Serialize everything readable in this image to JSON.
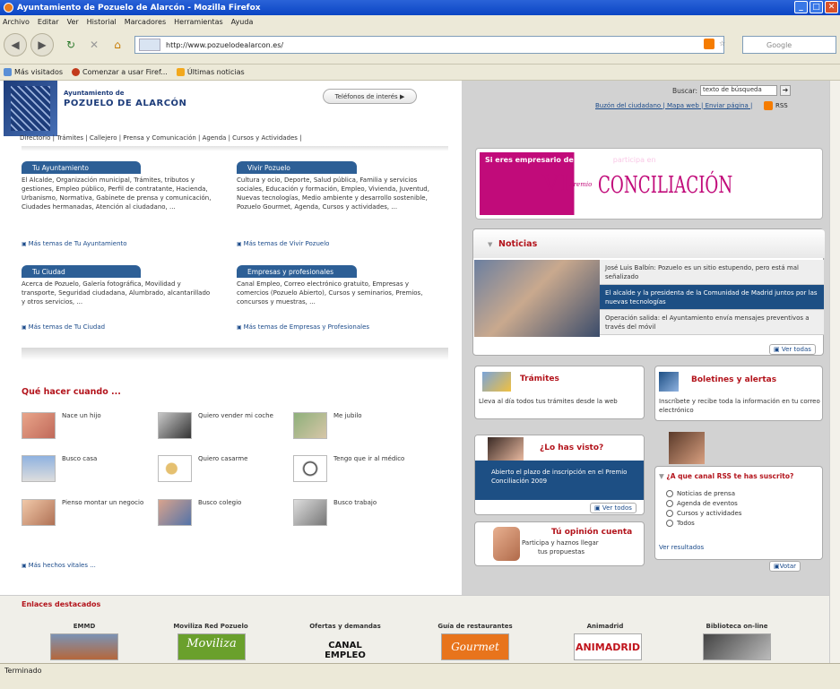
{
  "window": {
    "title": "Ayuntamiento de Pozuelo de Alarcón - Mozilla Firefox"
  },
  "menu": [
    "Archivo",
    "Editar",
    "Ver",
    "Historial",
    "Marcadores",
    "Herramientas",
    "Ayuda"
  ],
  "nav": {
    "url": "http://www.pozuelodealarcon.es/",
    "search_placeholder": "Google"
  },
  "bookmarks": [
    "Más visitados",
    "Comenzar a usar Firef...",
    "Últimas noticias"
  ],
  "header": {
    "org_small": "Ayuntamiento de",
    "org_big": "POZUELO DE ALARCÓN",
    "phones_button": "Teléfonos de interés",
    "search_label": "Buscar:",
    "search_value": "texto de búsqueda",
    "util_links": "Buzón del ciudadano | Mapa web | Enviar página |",
    "rss": "RSS",
    "topnav": "Directorio | Trámites | Callejero | Prensa y Comunicación | Agenda | Cursos y Actividades |"
  },
  "sections": [
    {
      "title": "Tu Ayuntamiento",
      "text": "El Alcalde, Organización municipal, Trámites, tributos y gestiones, Empleo público, Perfil de contratante, Hacienda, Urbanismo, Normativa, Gabinete de prensa y comunicación, Ciudades hermanadas, Atención al ciudadano, ...",
      "more": "Más temas de Tu Ayuntamiento"
    },
    {
      "title": "Vivir Pozuelo",
      "text": "Cultura y ocio, Deporte, Salud pública, Familia y servicios sociales, Educación y formación, Empleo, Vivienda, Juventud, Nuevas tecnologías, Medio ambiente y desarrollo sostenible, Pozuelo Gourmet, Agenda, Cursos y actividades, ...",
      "more": "Más temas de Vivir Pozuelo"
    },
    {
      "title": "Tu Ciudad",
      "text": "Acerca de Pozuelo, Galería fotográfica, Movilidad y transporte, Seguridad ciudadana, Alumbrado, alcantarillado y otros servicios, ...",
      "more": "Más temas de Tu Ciudad"
    },
    {
      "title": "Empresas y profesionales",
      "text": "Canal Empleo, Correo electrónico gratuito, Empresas y comercios (Pozuelo Abierto), Cursos y seminarios, Premios, concursos y muestras, ...",
      "more": "Más temas de Empresas y Profesionales"
    }
  ],
  "quehacer": {
    "title": "Qué hacer cuando ...",
    "items": [
      "Nace un hijo",
      "Quiero vender mi coche",
      "Me jubilo",
      "Busco casa",
      "Quiero casarme",
      "Tengo que ir al médico",
      "Pienso montar un negocio",
      "Busco colegio",
      "Busco trabajo"
    ],
    "more": "Más hechos vitales ..."
  },
  "banner": {
    "line1": "Si eres empresario de Pozuelo,",
    "line1b": "participa en",
    "roman": "VI",
    "premio": "Premio",
    "word": "CONCILIACIÓN"
  },
  "noticias": {
    "title": "Noticias",
    "items": [
      "José Luis Balbín: Pozuelo es un sitio estupendo, pero está mal señalizado",
      "El alcalde y la presidenta de la Comunidad de Madrid juntos por las nuevas tecnologías",
      "Operación salida: el Ayuntamiento envía mensajes preventivos a través del móvil"
    ],
    "ver_todas": "Ver todas"
  },
  "tramites": {
    "title": "Trámites",
    "text": "Lleva al día todos tus trámites desde la web"
  },
  "boletines": {
    "title": "Boletines y alertas",
    "text": "Inscríbete y recibe toda la información en tu correo electrónico"
  },
  "lohasvisto": {
    "title": "¿Lo has visto?",
    "text": "Abierto el plazo de inscripción en el Premio Conciliación 2009",
    "ver": "Ver todos"
  },
  "opinion": {
    "title": "Tú opinión cuenta",
    "text1": "Participa y haznos llegar",
    "text2": "tus propuestas"
  },
  "encuesta": {
    "title": "¿A que canal RSS te has suscrito?",
    "options": [
      "Noticias de prensa",
      "Agenda de eventos",
      "Cursos y actividades",
      "Todos"
    ],
    "results": "Ver resultados",
    "vote": "Votar"
  },
  "enlaces": {
    "title": "Enlaces destacados",
    "items": [
      "EMMD",
      "Moviliza Red Pozuelo",
      "Ofertas y demandas",
      "Guía de restaurantes",
      "Animadrid",
      "Biblioteca on-line"
    ],
    "logos": [
      "Moviliza",
      "CANAL EMPLEO",
      "Gourmet",
      "ANIMADRID"
    ]
  },
  "status": "Terminado",
  "colors": {
    "brand_blue": "#2d5f96",
    "accent_red": "#b3141c",
    "banner_magenta": "#c10b7a"
  }
}
